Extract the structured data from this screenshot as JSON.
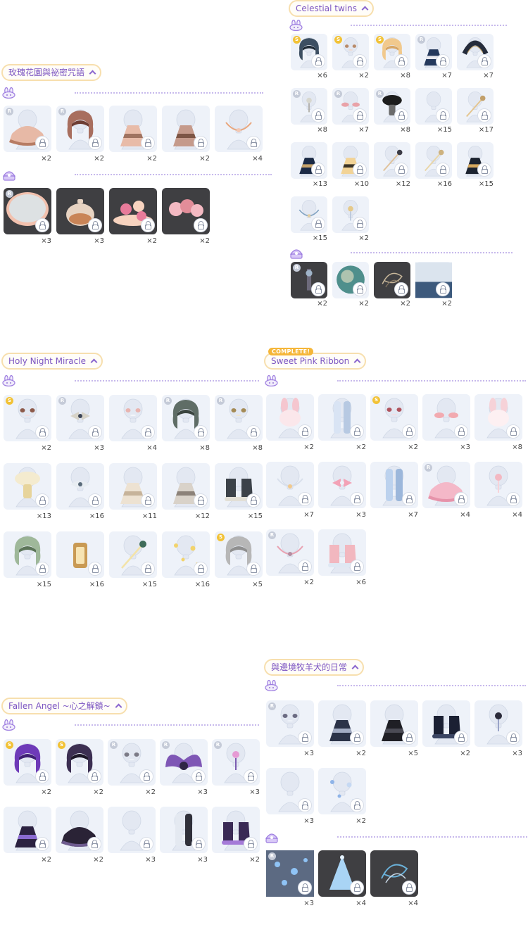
{
  "colors": {
    "accent": "#7c55c2",
    "tag_border": "#f7dfae",
    "rarity_s": "#f2c236",
    "rarity_r": "#c5cbd8",
    "dots": "#c7b9ec"
  },
  "sections": [
    {
      "id": "rose",
      "title": "玫瑰花園與祕密咒語",
      "complete": "",
      "rows": [
        {
          "icon": "bunny-icon",
          "items": [
            {
              "rarity": "r",
              "count": "×2",
              "art": "skirt",
              "c1": "#e7b9a6",
              "c2": "#b77c64"
            },
            {
              "rarity": "r",
              "count": "×2",
              "art": "hair",
              "c1": "#a86e5e",
              "c2": "#6d3d33"
            },
            {
              "rarity": "",
              "count": "×2",
              "art": "dress",
              "c1": "#e8bba8",
              "c2": "#a07360"
            },
            {
              "rarity": "",
              "count": "×2",
              "art": "dress",
              "c1": "#c59a8b",
              "c2": "#7d5545"
            },
            {
              "rarity": "",
              "count": "×4",
              "art": "necklace",
              "c1": "#f3c8b4",
              "c2": "#e9a67d"
            }
          ]
        },
        {
          "icon": "shell-icon",
          "items": [
            {
              "rarity": "r",
              "count": "×3",
              "art": "mirror",
              "c1": "#dde1e3",
              "c2": "#f2c1ae",
              "dark": true
            },
            {
              "rarity": "",
              "count": "×3",
              "art": "teapot",
              "c1": "#e7d3c2",
              "c2": "#c98457",
              "dark": true
            },
            {
              "rarity": "",
              "count": "×2",
              "art": "cakes",
              "c1": "#f7d3bf",
              "c2": "#e87b9a",
              "dark": true
            },
            {
              "rarity": "",
              "count": "×2",
              "art": "roses",
              "c1": "#f3b9c2",
              "c2": "#e28d99",
              "dark": true
            }
          ]
        }
      ]
    },
    {
      "id": "celestial",
      "title": "Celestial twins",
      "complete": "",
      "rows": [
        {
          "icon": "bunny-icon",
          "items": [
            {
              "rarity": "s",
              "count": "×6",
              "art": "hair",
              "c1": "#3d4f62",
              "c2": "#1f2a35"
            },
            {
              "rarity": "s",
              "count": "×2",
              "art": "face",
              "c1": "#b98b6a",
              "c2": "#f2d6c6"
            },
            {
              "rarity": "s",
              "count": "×8",
              "art": "hair",
              "c1": "#f1c98d",
              "c2": "#d8a664"
            },
            {
              "rarity": "r",
              "count": "×7",
              "art": "dress",
              "c1": "#25395c",
              "c2": "#e9e9ee"
            },
            {
              "rarity": "",
              "count": "×7",
              "art": "halo",
              "c1": "#252c3b",
              "c2": "#c5a66d"
            }
          ],
          "more": [
            {
              "rarity": "r",
              "count": "×8",
              "art": "pin",
              "c1": "#d7d7cf",
              "c2": "#a5a29a"
            },
            {
              "rarity": "r",
              "count": "×7",
              "art": "blush",
              "c1": "#e9a2a8",
              "c2": "#d3d7de"
            },
            {
              "rarity": "r",
              "count": "×8",
              "art": "hat",
              "c1": "#1d1d1d",
              "c2": "#6b6b6b"
            },
            {
              "rarity": "",
              "count": "×15",
              "art": "blank",
              "c1": "#dde4ee",
              "c2": "#dde4ee"
            },
            {
              "rarity": "",
              "count": "×17",
              "art": "wand",
              "c1": "#e4c58f",
              "c2": "#c2a06b"
            }
          ],
          "more2": [
            {
              "rarity": "",
              "count": "×13",
              "art": "dress",
              "c1": "#1b2a45",
              "c2": "#c7a36b"
            },
            {
              "rarity": "",
              "count": "×10",
              "art": "dress",
              "c1": "#f2d396",
              "c2": "#3a3326"
            },
            {
              "rarity": "",
              "count": "×12",
              "art": "wand",
              "c1": "#e0c29a",
              "c2": "#3b3b45"
            },
            {
              "rarity": "",
              "count": "×16",
              "art": "wand",
              "c1": "#e9d6a8",
              "c2": "#cdb27f"
            },
            {
              "rarity": "",
              "count": "×15",
              "art": "dress",
              "c1": "#1c2330",
              "c2": "#d6a85e"
            }
          ],
          "more3": [
            {
              "rarity": "",
              "count": "×15",
              "art": "necklace",
              "c1": "#e2cfa3",
              "c2": "#7fa1c1"
            },
            {
              "rarity": "",
              "count": "×2",
              "art": "pin",
              "c1": "#e5c98a",
              "c2": "#b3c2d8"
            }
          ]
        },
        {
          "icon": "shell-icon",
          "items": [
            {
              "rarity": "r",
              "count": "×2",
              "art": "lamp",
              "c1": "#6d6a7b",
              "c2": "#9fb3c8",
              "dark": true
            },
            {
              "rarity": "",
              "count": "×2",
              "art": "orb",
              "c1": "#4f8f8c",
              "c2": "#efe6c6"
            },
            {
              "rarity": "",
              "count": "×2",
              "art": "swirl",
              "c1": "#c9b89b",
              "c2": "#8a7a63",
              "dark": true
            },
            {
              "rarity": "",
              "count": "×2",
              "art": "sea",
              "c1": "#3d5a7d",
              "c2": "#dbe4ee"
            }
          ]
        }
      ]
    },
    {
      "id": "holy",
      "title": "Holy Night Miracle",
      "complete": "",
      "rows": [
        {
          "icon": "bunny-icon",
          "items": [
            {
              "rarity": "s",
              "count": "×2",
              "art": "face",
              "c1": "#8c5a4a",
              "c2": "#f0dde0"
            },
            {
              "rarity": "r",
              "count": "×3",
              "art": "bow",
              "c1": "#d7d3c8",
              "c2": "#3d4657"
            },
            {
              "rarity": "",
              "count": "×4",
              "art": "face",
              "c1": "#e8b4b0",
              "c2": "#f4f6fa"
            },
            {
              "rarity": "r",
              "count": "×8",
              "art": "hair",
              "c1": "#5f6d66",
              "c2": "#3a443f"
            },
            {
              "rarity": "r",
              "count": "×8",
              "art": "face",
              "c1": "#a48a55",
              "c2": "#f0e6cf"
            }
          ],
          "more": [
            {
              "rarity": "",
              "count": "×13",
              "art": "hat",
              "c1": "#f4ebcf",
              "c2": "#e7d49b"
            },
            {
              "rarity": "",
              "count": "×16",
              "art": "bow",
              "c1": "#e8edf2",
              "c2": "#5a6b7a"
            },
            {
              "rarity": "",
              "count": "×11",
              "art": "dress",
              "c1": "#ede2d2",
              "c2": "#c6b39a"
            },
            {
              "rarity": "",
              "count": "×12",
              "art": "dress",
              "c1": "#d9d2c9",
              "c2": "#8c8279"
            },
            {
              "rarity": "",
              "count": "×15",
              "art": "boots",
              "c1": "#3c4249",
              "c2": "#e2dfd6"
            }
          ],
          "more2": [
            {
              "rarity": "",
              "count": "×15",
              "art": "hair",
              "c1": "#9fb89a",
              "c2": "#5c7558"
            },
            {
              "rarity": "",
              "count": "×16",
              "art": "lantern",
              "c1": "#c99a54",
              "c2": "#f7e4b3"
            },
            {
              "rarity": "",
              "count": "×15",
              "art": "wand",
              "c1": "#f3e3a8",
              "c2": "#3f6c5a"
            },
            {
              "rarity": "",
              "count": "×16",
              "art": "sparkle",
              "c1": "#f2d36c",
              "c2": "#f2d36c"
            },
            {
              "rarity": "s",
              "count": "×5",
              "art": "hair",
              "c1": "#b7b7b7",
              "c2": "#8f8f8f"
            }
          ]
        }
      ]
    },
    {
      "id": "pink",
      "title": "Sweet Pink Ribbon",
      "complete": "COMPLETE!",
      "rows": [
        {
          "icon": "bunny-icon",
          "items": [
            {
              "rarity": "",
              "count": "×2",
              "art": "bunny",
              "c1": "#f5c6cf",
              "c2": "#fbe7eb"
            },
            {
              "rarity": "",
              "count": "×2",
              "art": "stockings",
              "c1": "#d9e4f4",
              "c2": "#b7c9e2"
            },
            {
              "rarity": "s",
              "count": "×2",
              "art": "face",
              "c1": "#b0545e",
              "c2": "#f2dde2"
            },
            {
              "rarity": "",
              "count": "×3",
              "art": "blush",
              "c1": "#f2aab0",
              "c2": "#eef2f9"
            },
            {
              "rarity": "",
              "count": "×8",
              "art": "bunny",
              "c1": "#f6d2d8",
              "c2": "#fdf0f2"
            }
          ],
          "more": [
            {
              "rarity": "",
              "count": "×7",
              "art": "necklace",
              "c1": "#f1c98d",
              "c2": "#d9e0ec"
            },
            {
              "rarity": "",
              "count": "×3",
              "art": "bow",
              "c1": "#f3a2b6",
              "c2": "#eef2f9"
            },
            {
              "rarity": "",
              "count": "×7",
              "art": "stockings",
              "c1": "#bcd2ee",
              "c2": "#9cb7db"
            },
            {
              "rarity": "r",
              "count": "×4",
              "art": "skirt",
              "c1": "#f4b8c8",
              "c2": "#e693aa"
            },
            {
              "rarity": "",
              "count": "×4",
              "art": "pin",
              "c1": "#f3b8c2",
              "c2": "#f7d3d9"
            }
          ],
          "more2": [
            {
              "rarity": "r",
              "count": "×2",
              "art": "necklace",
              "c1": "#b48ca0",
              "c2": "#e9a1b1"
            },
            {
              "rarity": "",
              "count": "×6",
              "art": "boots",
              "c1": "#f2b7bf",
              "c2": "#dfe8f3"
            }
          ]
        }
      ]
    },
    {
      "id": "fallen",
      "title": "Fallen Angel ~心之解鎖~",
      "complete": "",
      "rows": [
        {
          "icon": "bunny-icon",
          "items": [
            {
              "rarity": "s",
              "count": "×2",
              "art": "hair",
              "c1": "#6e3ab8",
              "c2": "#3e1f73"
            },
            {
              "rarity": "s",
              "count": "×2",
              "art": "hair",
              "c1": "#3c2f52",
              "c2": "#1c1727"
            },
            {
              "rarity": "r",
              "count": "×2",
              "art": "face",
              "c1": "#7b7a86",
              "c2": "#eef2f9"
            },
            {
              "rarity": "r",
              "count": "×3",
              "art": "wings",
              "c1": "#7e56b5",
              "c2": "#2f2545"
            },
            {
              "rarity": "r",
              "count": "×3",
              "art": "pin",
              "c1": "#e69ad4",
              "c2": "#7b5cb1"
            }
          ],
          "more": [
            {
              "rarity": "",
              "count": "×2",
              "art": "dress",
              "c1": "#2b2140",
              "c2": "#8a6ad0"
            },
            {
              "rarity": "",
              "count": "×2",
              "art": "skirt",
              "c1": "#2a2336",
              "c2": "#6e5b8f"
            },
            {
              "rarity": "",
              "count": "×3",
              "art": "blank",
              "c1": "#dde4ee",
              "c2": "#dde4ee"
            },
            {
              "rarity": "",
              "count": "×3",
              "art": "stockings",
              "c1": "#e4e9f1",
              "c2": "#30303a"
            },
            {
              "rarity": "",
              "count": "×2",
              "art": "boots",
              "c1": "#3a2a55",
              "c2": "#a57ad8"
            }
          ]
        }
      ]
    },
    {
      "id": "shepherd",
      "title": "與邊境牧羊犬的日常",
      "complete": "",
      "rows": [
        {
          "icon": "bunny-icon",
          "items": [
            {
              "rarity": "r",
              "count": "×3",
              "art": "face",
              "c1": "#6b6b82",
              "c2": "#eef2f9"
            },
            {
              "rarity": "",
              "count": "×2",
              "art": "dress",
              "c1": "#2b3348",
              "c2": "#a3adc4"
            },
            {
              "rarity": "",
              "count": "×5",
              "art": "dress",
              "c1": "#1f1f25",
              "c2": "#4b4b55"
            },
            {
              "rarity": "",
              "count": "×2",
              "art": "boots",
              "c1": "#1b2033",
              "c2": "#3b4563"
            },
            {
              "rarity": "",
              "count": "×3",
              "art": "pin",
              "c1": "#2b2b3a",
              "c2": "#9aa4c8"
            }
          ],
          "more": [
            {
              "rarity": "",
              "count": "×3",
              "art": "blank",
              "c1": "#dde4ee",
              "c2": "#dde4ee"
            },
            {
              "rarity": "",
              "count": "×2",
              "art": "sparkle",
              "c1": "#8fb4e8",
              "c2": "#c6d9f3"
            }
          ]
        },
        {
          "icon": "shell-icon",
          "items": [
            {
              "rarity": "r",
              "count": "×3",
              "art": "lights",
              "c1": "#5c6a82",
              "c2": "#8fc3f5",
              "dark": true
            },
            {
              "rarity": "",
              "count": "×4",
              "art": "tree",
              "c1": "#a9d4f5",
              "c2": "#e6f3ff",
              "dark": true
            },
            {
              "rarity": "",
              "count": "×4",
              "art": "swirl",
              "c1": "#6ab0d8",
              "c2": "#c7d6e4",
              "dark": true
            }
          ]
        }
      ]
    }
  ]
}
